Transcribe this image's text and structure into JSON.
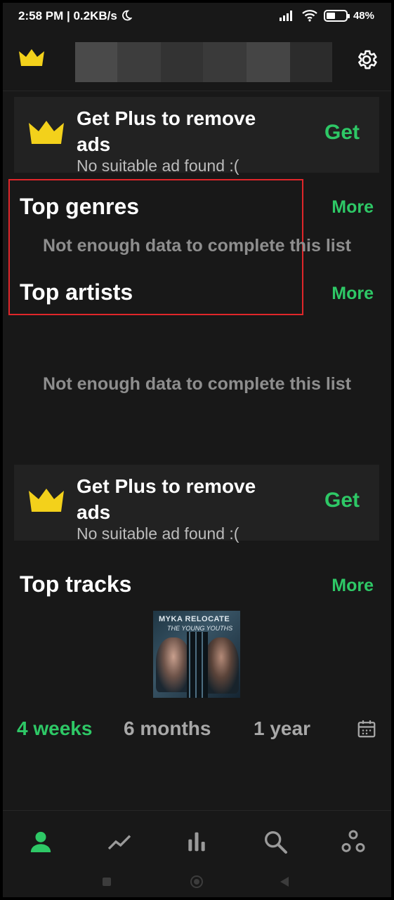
{
  "status_bar": {
    "time": "2:58 PM | 0.2KB/s",
    "moon_icon": "moon-icon",
    "signal_icon": "signal-icon",
    "wifi_icon": "wifi-icon",
    "battery_level": 48,
    "battery_text": "48%"
  },
  "app_bar": {
    "logo_icon": "crown-icon",
    "settings_icon": "gear-icon"
  },
  "ads": [
    {
      "title": "Get Plus to remove ads",
      "subtitle": "No suitable ad found :(",
      "action": "Get"
    },
    {
      "title": "Get Plus to remove ads",
      "subtitle": "No suitable ad found :(",
      "action": "Get"
    }
  ],
  "sections": {
    "genres": {
      "title": "Top genres",
      "more": "More",
      "empty": "Not enough data to complete this list"
    },
    "artists": {
      "title": "Top artists",
      "more": "More",
      "empty": "Not enough data to complete this list"
    },
    "tracks": {
      "title": "Top tracks",
      "more": "More",
      "album_band": "MYKA RELOCATE",
      "album_subtitle": "THE YOUNG YOUTHS"
    }
  },
  "time_range": {
    "options": [
      "4 weeks",
      "6 months",
      "1 year"
    ],
    "selected": "4 weeks",
    "calendar_icon": "calendar-icon"
  },
  "bottom_nav": [
    "profile-icon",
    "trend-icon",
    "bar-chart-icon",
    "search-icon",
    "share-icon"
  ],
  "colors": {
    "accent": "#2ec866",
    "crown": "#f3d11b",
    "background": "#181818",
    "card": "#222222",
    "highlight": "#e0262a"
  }
}
